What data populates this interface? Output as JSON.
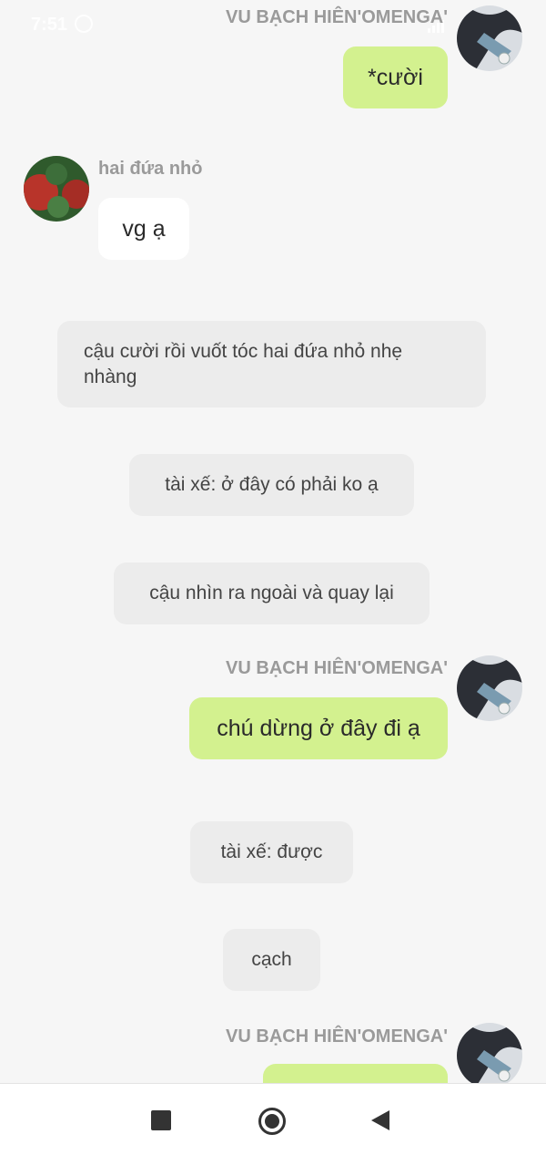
{
  "status_bar": {
    "time": "7:51"
  },
  "messages": [
    {
      "type": "sent",
      "sender": "VU BẠCH HIÊN'OMENGA'",
      "text": "*cười"
    },
    {
      "type": "received",
      "sender": "hai đứa nhỏ",
      "text": "vg ạ"
    },
    {
      "type": "narration",
      "text": "cậu cười rồi vuốt tóc hai đứa nhỏ nhẹ nhàng"
    },
    {
      "type": "narration",
      "text": "tài xế: ở đây có phải ko ạ"
    },
    {
      "type": "narration",
      "text": "cậu nhìn ra ngoài và quay lại"
    },
    {
      "type": "sent",
      "sender": "VU BẠCH HIÊN'OMENGA'",
      "text": "chú dừng ở đây đi ạ"
    },
    {
      "type": "narration",
      "text": "tài xế: được"
    },
    {
      "type": "narration",
      "text": "cạch"
    },
    {
      "type": "sent",
      "sender": "VU BẠCH HIÊN'OMENGA'",
      "text": ""
    }
  ],
  "nav_bar": {
    "recents_icon": "square-icon",
    "home_icon": "home-circle-icon",
    "back_icon": "back-triangle-icon"
  },
  "colors": {
    "background": "#f6f6f6",
    "sent_bubble": "#d3f18f",
    "received_bubble": "#ffffff",
    "narration_bubble": "#ececec",
    "sender_name": "#9a9a9a"
  }
}
